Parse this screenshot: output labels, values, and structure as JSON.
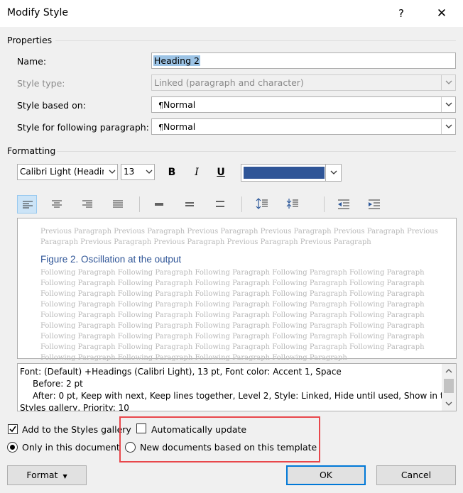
{
  "window": {
    "title": "Modify Style",
    "help": "?",
    "close": "✕"
  },
  "properties": {
    "section_label": "Properties",
    "name_label": "Name:",
    "name_value": "Heading 2",
    "style_type_label": "Style type:",
    "style_type_value": "Linked (paragraph and character)",
    "based_on_label": "Style based on:",
    "based_on_value": "Normal",
    "following_label": "Style for following paragraph:",
    "following_value": "Normal",
    "paragraph_mark": "¶"
  },
  "formatting": {
    "section_label": "Formatting",
    "font_value": "Calibri Light (Headin",
    "size_value": "13",
    "bold": "B",
    "italic": "I",
    "underline": "U",
    "font_color": "#2f5597"
  },
  "preview": {
    "previous_line1": "Previous Paragraph Previous Paragraph Previous Paragraph Previous Paragraph Previous Paragraph Previous",
    "previous_line2": "Paragraph Previous Paragraph Previous Paragraph Previous Paragraph Previous Paragraph",
    "heading": "Figure 2. Oscillation at the output",
    "following_lines": [
      "Following Paragraph Following Paragraph Following Paragraph Following Paragraph Following Paragraph",
      "Following Paragraph Following Paragraph Following Paragraph Following Paragraph Following Paragraph",
      "Following Paragraph Following Paragraph Following Paragraph Following Paragraph Following Paragraph",
      "Following Paragraph Following Paragraph Following Paragraph Following Paragraph Following Paragraph",
      "Following Paragraph Following Paragraph Following Paragraph Following Paragraph Following Paragraph",
      "Following Paragraph Following Paragraph Following Paragraph Following Paragraph Following Paragraph",
      "Following Paragraph Following Paragraph Following Paragraph Following Paragraph Following Paragraph",
      "Following Paragraph Following Paragraph Following Paragraph Following Paragraph Following Paragraph",
      "Following Paragraph Following Paragraph Following Paragraph Following Paragraph"
    ]
  },
  "description": {
    "line1": "Font: (Default) +Headings (Calibri Light), 13 pt, Font color: Accent 1, Space",
    "line2": "Before:  2 pt",
    "line3": "After:  0 pt, Keep with next, Keep lines together, Level 2, Style: Linked, Hide until used, Show in the",
    "line4": "Styles gallery, Priority: 10"
  },
  "options": {
    "add_to_gallery_label": "Add to the Styles gallery",
    "add_to_gallery_checked": true,
    "auto_update_label": "Automatically update",
    "auto_update_checked": false,
    "only_doc_label": "Only in this document",
    "new_docs_label": "New documents based on this template",
    "selected_scope": "only_in_document"
  },
  "buttons": {
    "format": "Format",
    "ok": "OK",
    "cancel": "Cancel"
  }
}
